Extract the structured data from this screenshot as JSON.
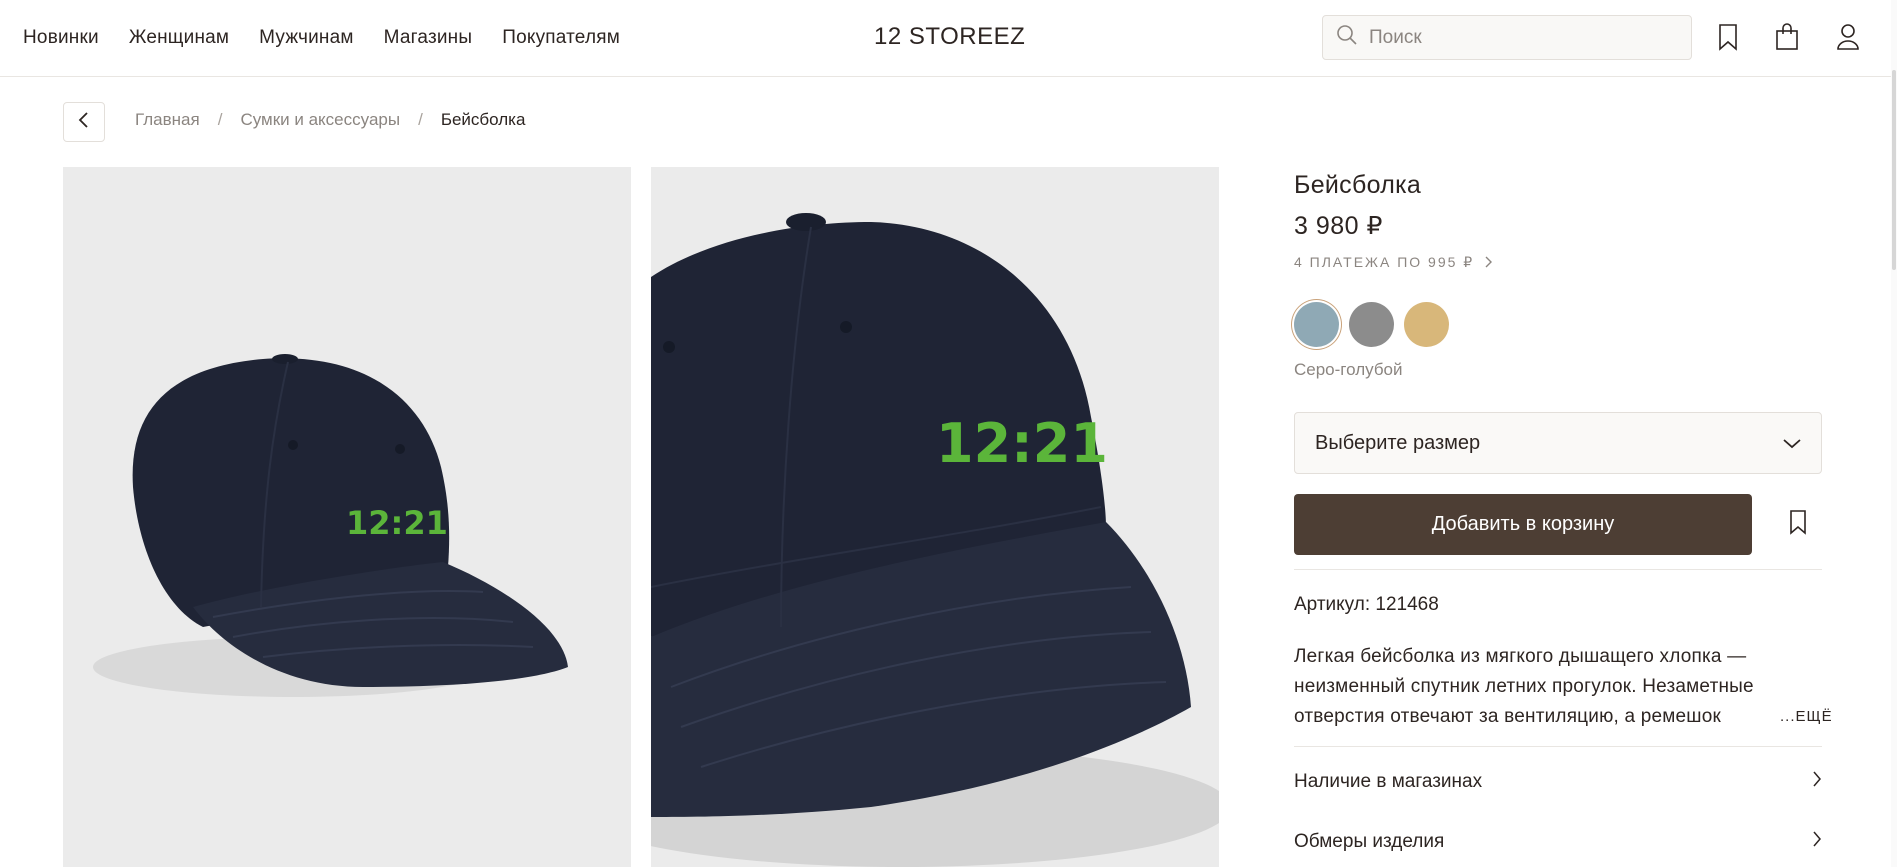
{
  "header": {
    "nav": [
      "Новинки",
      "Женщинам",
      "Мужчинам",
      "Магазины",
      "Покупателям"
    ],
    "logo": "12 STOREEZ",
    "search_placeholder": "Поиск"
  },
  "breadcrumb": {
    "items": [
      "Главная",
      "Сумки и аксессуары"
    ],
    "current": "Бейсболка",
    "separator": "/"
  },
  "product": {
    "title": "Бейсболка",
    "price": "3 980 ₽",
    "installments": "4 ПЛАТЕЖА ПО 995 ₽",
    "swatches": [
      {
        "color": "#8fa9b5",
        "selected": true
      },
      {
        "color": "#8c8c8c",
        "selected": false
      },
      {
        "color": "#d8b77a",
        "selected": false
      }
    ],
    "color_name": "Серо-голубой",
    "size_select": "Выберите размер",
    "add_to_cart": "Добавить в корзину",
    "article": "Артикул: 121468",
    "description": "Легкая бейсболка из мягкого дышащего хлопка — неизменный спутник летних прогулок. Незаметные отверстия отвечают за вентиляцию, а ремешок",
    "more": "...ЕЩЁ",
    "links": [
      "Наличие в магазинах",
      "Обмеры изделия"
    ],
    "embroidery": "12:21"
  },
  "colors": {
    "accent_button": "#4d3e34",
    "cap": "#1f2435",
    "embroidery": "#5bb53a",
    "photo_bg": "#ebebeb"
  }
}
